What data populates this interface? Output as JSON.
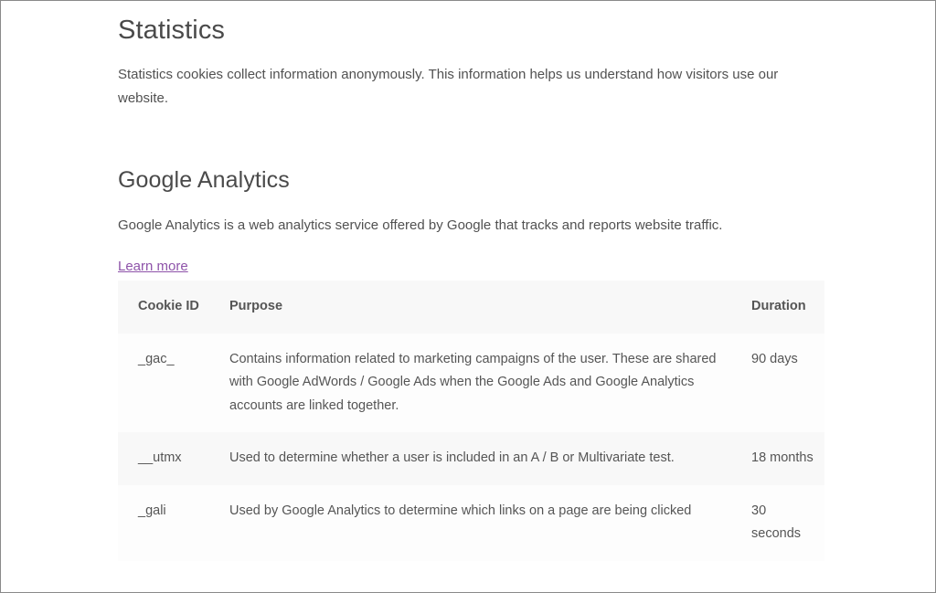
{
  "statistics": {
    "title": "Statistics",
    "description": "Statistics cookies collect information anonymously. This information helps us understand how visitors use our website."
  },
  "google_analytics": {
    "title": "Google Analytics",
    "description": "Google Analytics is a web analytics service offered by Google that tracks and reports website traffic.",
    "learn_more_label": "Learn more"
  },
  "cookie_table": {
    "headers": {
      "cookie_id": "Cookie ID",
      "purpose": "Purpose",
      "duration": "Duration"
    },
    "rows": [
      {
        "id": "_gac_",
        "purpose": "Contains information related to marketing campaigns of the user. These are shared with Google AdWords / Google Ads when the Google Ads and Google Analytics accounts are linked together.",
        "duration": "90 days"
      },
      {
        "id": "__utmx",
        "purpose": "Used to determine whether a user is included in an A / B or Multivariate test.",
        "duration": "18 months"
      },
      {
        "id": "_gali",
        "purpose": "Used by Google Analytics to determine which links on a page are being clicked",
        "duration": "30 seconds"
      }
    ]
  }
}
